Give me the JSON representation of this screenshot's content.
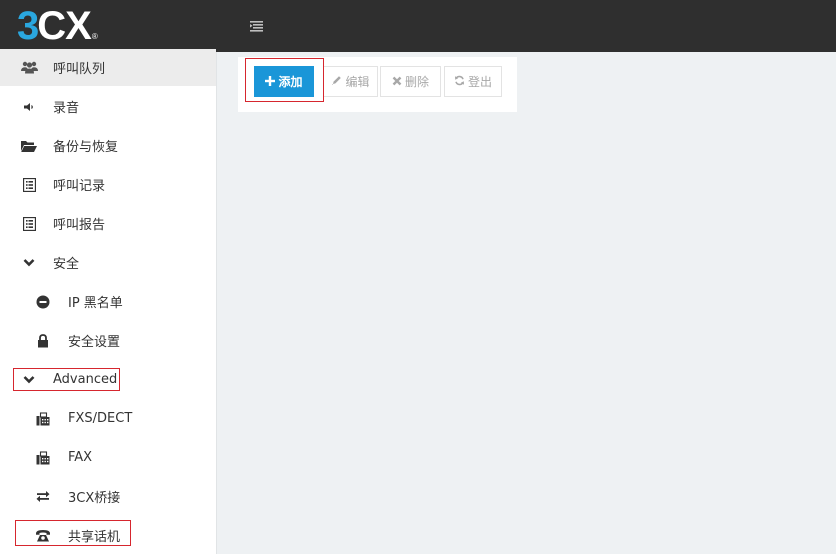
{
  "header": {
    "logo_number": "3",
    "logo_letters": "CX",
    "logo_mark": "®",
    "menu_icon": "hamburger-menu-icon"
  },
  "sidebar": {
    "items": [
      {
        "label": "呼叫队列",
        "icon": "users-icon",
        "active": true
      },
      {
        "label": "录音",
        "icon": "volume-icon"
      },
      {
        "label": "备份与恢复",
        "icon": "folder-open-icon"
      },
      {
        "label": "呼叫记录",
        "icon": "list-icon"
      },
      {
        "label": "呼叫报告",
        "icon": "list-icon"
      },
      {
        "label": "安全",
        "icon": "chevron-down-icon"
      },
      {
        "label": "IP 黑名单",
        "icon": "minus-circle-icon"
      },
      {
        "label": "安全设置",
        "icon": "lock-icon"
      },
      {
        "label": "Advanced",
        "icon": "chevron-down-icon"
      },
      {
        "label": "FXS/DECT",
        "icon": "fax-icon"
      },
      {
        "label": "FAX",
        "icon": "fax-icon"
      },
      {
        "label": "3CX桥接",
        "icon": "exchange-icon"
      },
      {
        "label": "共享话机",
        "icon": "phone-icon"
      }
    ]
  },
  "toolbar": {
    "add": {
      "label": "添加",
      "icon": "plus-icon"
    },
    "edit": {
      "label": "编辑",
      "icon": "pencil-icon"
    },
    "delete": {
      "label": "删除",
      "icon": "times-icon"
    },
    "logout": {
      "label": "登出",
      "icon": "refresh-icon"
    }
  },
  "colors": {
    "topbar": "#2f2f2f",
    "brand_blue": "#2aa7df",
    "primary_button": "#1a96d8",
    "highlight_box": "#d6262e",
    "content_bg": "#eef1f3"
  }
}
